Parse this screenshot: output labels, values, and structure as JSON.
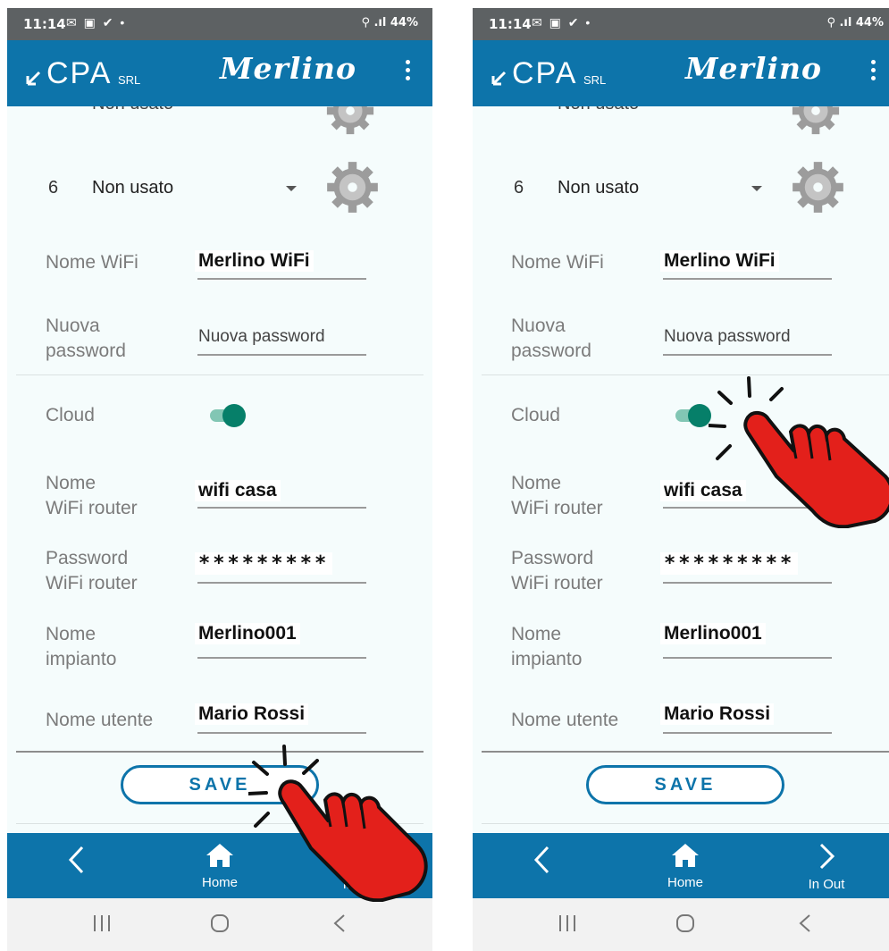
{
  "status": {
    "time": "11:14",
    "battery": "44%"
  },
  "app": {
    "logo_text": "CPA",
    "logo_suffix": "SRL",
    "title": "Merlino"
  },
  "relay": {
    "number": "6",
    "selected": "Non usato",
    "partial_above": "Non usato"
  },
  "fields": {
    "wifi_name": {
      "label": "Nome WiFi",
      "value": "Merlino WiFi"
    },
    "new_password": {
      "label_line1": "Nuova",
      "label_line2": "password",
      "placeholder": "Nuova password"
    },
    "cloud": {
      "label": "Cloud",
      "enabled": true
    },
    "router_name": {
      "label_line1": "Nome",
      "label_line2": "WiFi router",
      "value": "wifi casa"
    },
    "router_password": {
      "label_line1": "Password",
      "label_line2": "WiFi router",
      "value": "*********"
    },
    "plant_name": {
      "label_line1": "Nome",
      "label_line2": "impianto",
      "value": "Merlino001"
    },
    "user_name": {
      "label": "Nome utente",
      "value": "Mario Rossi"
    }
  },
  "save_label": "SAVE",
  "bottom_nav": {
    "home": "Home",
    "inout": "In Out"
  },
  "colors": {
    "accent": "#0d74aa",
    "toggle_on": "#067f69",
    "hand": "#e3201b"
  },
  "icons": [
    "logo-arrow-icon",
    "gear-icon",
    "chevron-down-icon",
    "home-icon",
    "chevron-left-icon",
    "chevron-right-icon",
    "recents-icon",
    "circle-home-icon",
    "back-icon",
    "tap-hand-icon"
  ]
}
